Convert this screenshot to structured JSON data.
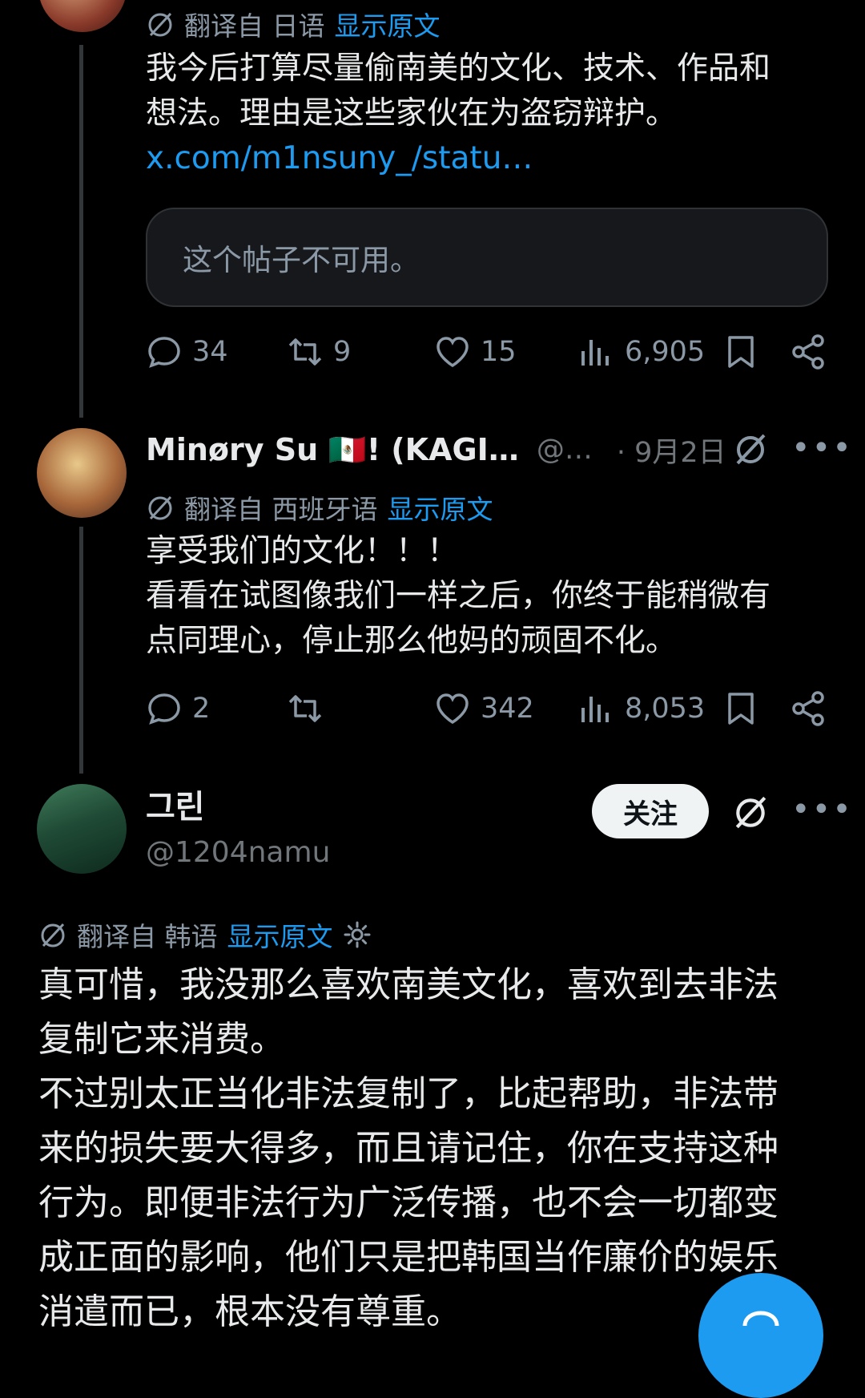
{
  "tweet1": {
    "translate_prefix": "翻译自 日语",
    "show_original": "显示原文",
    "lines": [
      "我今后打算尽量偷南美的文化、技术、作品和",
      "想法。理由是这些家伙在为盗窃辩护。"
    ],
    "link": "x.com/m1nsuny_/statu…",
    "unavailable": "这个帖子不可用。",
    "replies": "34",
    "retweets": "9",
    "likes": "15",
    "views": "6,905"
  },
  "tweet2": {
    "name": "Minøry Su 🇲🇽! (KAGI…",
    "handle": "@…",
    "date": "· 9月2日",
    "translate_prefix": "翻译自 西班牙语",
    "show_original": "显示原文",
    "lines": [
      "享受我们的文化！！！",
      "看看在试图像我们一样之后，你终于能稍微有",
      "点同理心，停止那么他妈的顽固不化。"
    ],
    "replies": "2",
    "retweets": "",
    "likes": "342",
    "views": "8,053"
  },
  "tweet3": {
    "name": "그린",
    "handle": "@1204namu",
    "follow": "关注",
    "translate_prefix": "翻译自 韩语",
    "show_original": "显示原文",
    "lines": [
      "真可惜，我没那么喜欢南美文化，喜欢到去非法",
      "复制它来消费。",
      "不过别太正当化非法复制了，比起帮助，非法带",
      "来的损失要大得多，而且请记住，你在支持这种",
      "行为。即便非法行为广泛传播，也不会一切都变",
      "成正面的影响，他们只是把韩国当作廉价的娱乐",
      "消遣而已，根本没有尊重。"
    ]
  },
  "icons": {
    "translate": "grok-translate-icon",
    "reply": "reply-icon",
    "retweet": "retweet-icon",
    "like": "heart-icon",
    "views": "views-icon",
    "bookmark": "bookmark-icon",
    "share": "share-icon",
    "more": "more-icon",
    "gear": "gear-icon"
  },
  "colors": {
    "background": "#000000",
    "accent": "#1d9bf0",
    "muted": "#8b98a5",
    "text": "#e7e9ea"
  }
}
